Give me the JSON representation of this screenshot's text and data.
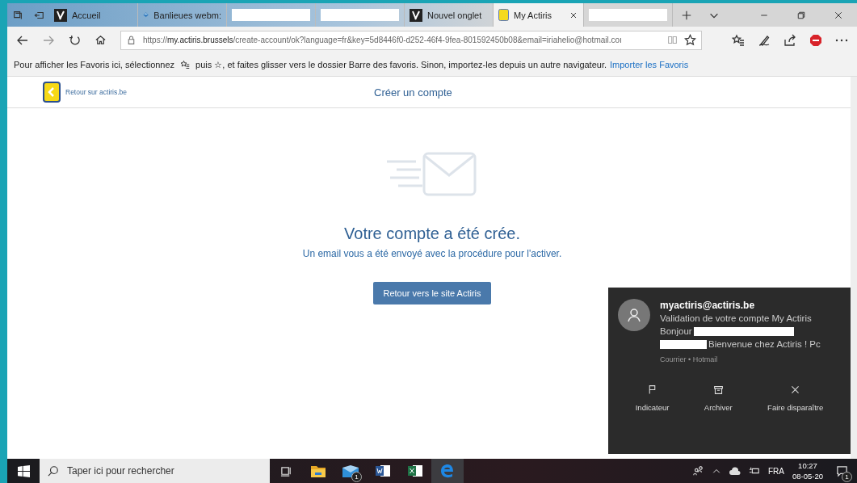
{
  "tabs": [
    {
      "label": "Accueil",
      "kind": "actiris",
      "selected": false
    },
    {
      "label": "Banlieues webm:",
      "kind": "globe",
      "selected": false
    },
    {
      "kind": "redacted",
      "selected": false
    },
    {
      "kind": "redacted",
      "selected": false
    },
    {
      "label": "Nouvel onglet",
      "kind": "actiris",
      "selected": false
    },
    {
      "label": "My Actiris",
      "kind": "page",
      "selected": true
    },
    {
      "kind": "redacted",
      "selected": false
    }
  ],
  "address": {
    "scheme": "https://",
    "host": "my.actiris.brussels",
    "path": "/create-account/ok?language=fr&key=5d8446f0-d252-46f4-9fea-801592450b08&email=iriahelio@hotmail.coı"
  },
  "favorites_bar": {
    "text_before": "Pour afficher les Favoris ici, sélectionnez",
    "text_mid": "puis ☆, et faites glisser vers le dossier Barre des favoris. Sinon, importez-les depuis un autre navigateur.",
    "link": "Importer les Favoris"
  },
  "site_header": {
    "back_link": "Retour sur actiris.be",
    "title": "Créer un compte"
  },
  "confirmation": {
    "heading": "Votre compte a été crée.",
    "message": "Un email vous a été envoyé avec la procédure pour l'activer.",
    "button": "Retour vers le site Actiris"
  },
  "notification": {
    "sender": "myactiris@actiris.be",
    "subject": "Validation de votre compte My Actiris",
    "greeting": "Bonjour",
    "preview": "Bienvenue chez Actiris ! Pc",
    "source": "Courrier • Hotmail",
    "actions": [
      {
        "label": "Indicateur",
        "kind": "flag"
      },
      {
        "label": "Archiver",
        "kind": "archive"
      },
      {
        "label": "Faire disparaître",
        "kind": "dismiss"
      }
    ]
  },
  "taskbar": {
    "search_placeholder": "Taper ici pour rechercher",
    "mail_badge": "1",
    "language": "FRA",
    "time": "10:27",
    "date": "08-05-20",
    "notification_badge": "1"
  }
}
